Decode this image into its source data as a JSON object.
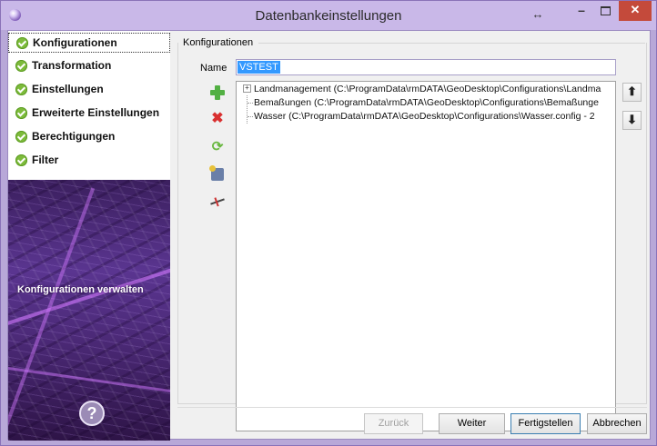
{
  "window": {
    "title": "Datenbankeinstellungen",
    "resize_indicator": "↔",
    "minimize": "–",
    "close": "✕"
  },
  "nav": {
    "items": [
      {
        "label": "Konfigurationen",
        "selected": true
      },
      {
        "label": "Transformation"
      },
      {
        "label": "Einstellungen"
      },
      {
        "label": "Erweiterte Einstellungen"
      },
      {
        "label": "Berechtigungen"
      },
      {
        "label": "Filter"
      }
    ],
    "caption": "Konfigurationen verwalten",
    "help": "?"
  },
  "group": {
    "title": "Konfigurationen"
  },
  "name_field": {
    "label": "Name",
    "value": "VSTEST"
  },
  "tree": {
    "items": [
      {
        "text": "Landmanagement (C:\\ProgramData\\rmDATA\\GeoDesktop\\Configurations\\Landma",
        "expandable": true,
        "expander": "+"
      },
      {
        "text": "Bemaßungen (C:\\ProgramData\\rmDATA\\GeoDesktop\\Configurations\\Bemaßunge"
      },
      {
        "text": "Wasser (C:\\ProgramData\\rmDATA\\GeoDesktop\\Configurations\\Wasser.config - 2"
      }
    ]
  },
  "side_icons": [
    "add-icon",
    "delete-icon",
    "refresh-icon",
    "database-settings-icon",
    "disconnect-icon"
  ],
  "move_buttons": {
    "up": "⬆",
    "down": "⬇"
  },
  "buttons": {
    "back": "Zurück",
    "next": "Weiter",
    "finish": "Fertigstellen",
    "cancel": "Abbrechen"
  },
  "colors": {
    "titlebar": "#c9b8e8",
    "close": "#c44a3b",
    "check": "#7dbb3b",
    "selection": "#3399ff"
  }
}
